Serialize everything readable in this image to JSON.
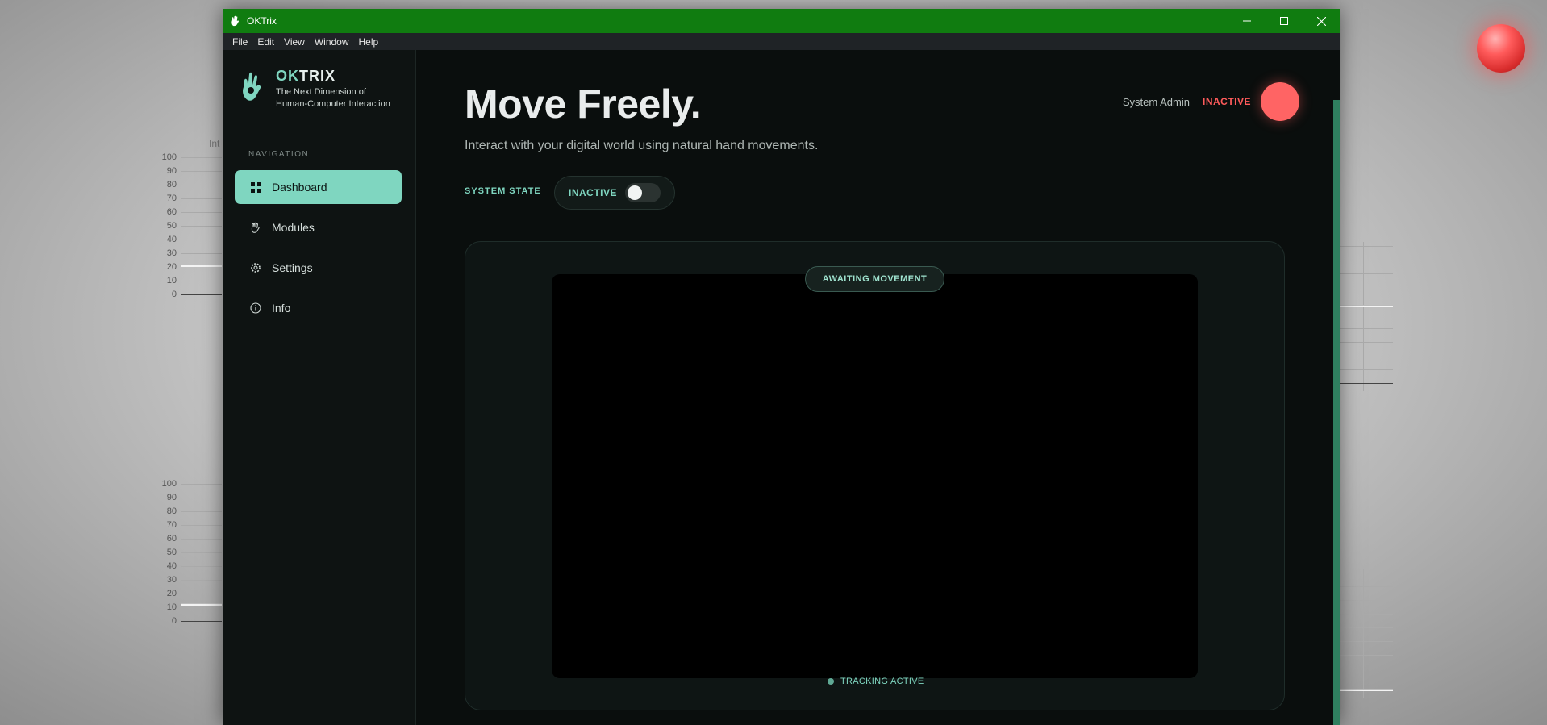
{
  "desktop": {
    "chart_label": "Int",
    "ticks": [
      "100",
      "90",
      "80",
      "70",
      "60",
      "50",
      "40",
      "30",
      "20",
      "10",
      "0"
    ]
  },
  "window": {
    "title": "OKTrix",
    "menu": [
      "File",
      "Edit",
      "View",
      "Window",
      "Help"
    ]
  },
  "sidebar": {
    "brand_ok": "OK",
    "brand_rest": "TRIX",
    "tagline_1": "The Next Dimension of",
    "tagline_2": "Human-Computer Interaction",
    "nav_heading": "NAVIGATION",
    "items": [
      {
        "label": "Dashboard",
        "icon": "grid-icon",
        "active": true
      },
      {
        "label": "Modules",
        "icon": "hand-icon",
        "active": false
      },
      {
        "label": "Settings",
        "icon": "gear-icon",
        "active": false
      },
      {
        "label": "Info",
        "icon": "info-icon",
        "active": false
      }
    ]
  },
  "header": {
    "title": "Move Freely.",
    "subtitle": "Interact with your digital world using natural hand movements.",
    "user_name": "System Admin",
    "user_status": "INACTIVE"
  },
  "system_state": {
    "label": "SYSTEM STATE",
    "value": "INACTIVE",
    "enabled": false
  },
  "camera": {
    "badge": "AWAITING MOVEMENT",
    "footer": "TRACKING ACTIVE"
  },
  "colors": {
    "accent": "#7fd6c0",
    "titlebar": "#107c10",
    "inactive": "#ff5b5b"
  }
}
